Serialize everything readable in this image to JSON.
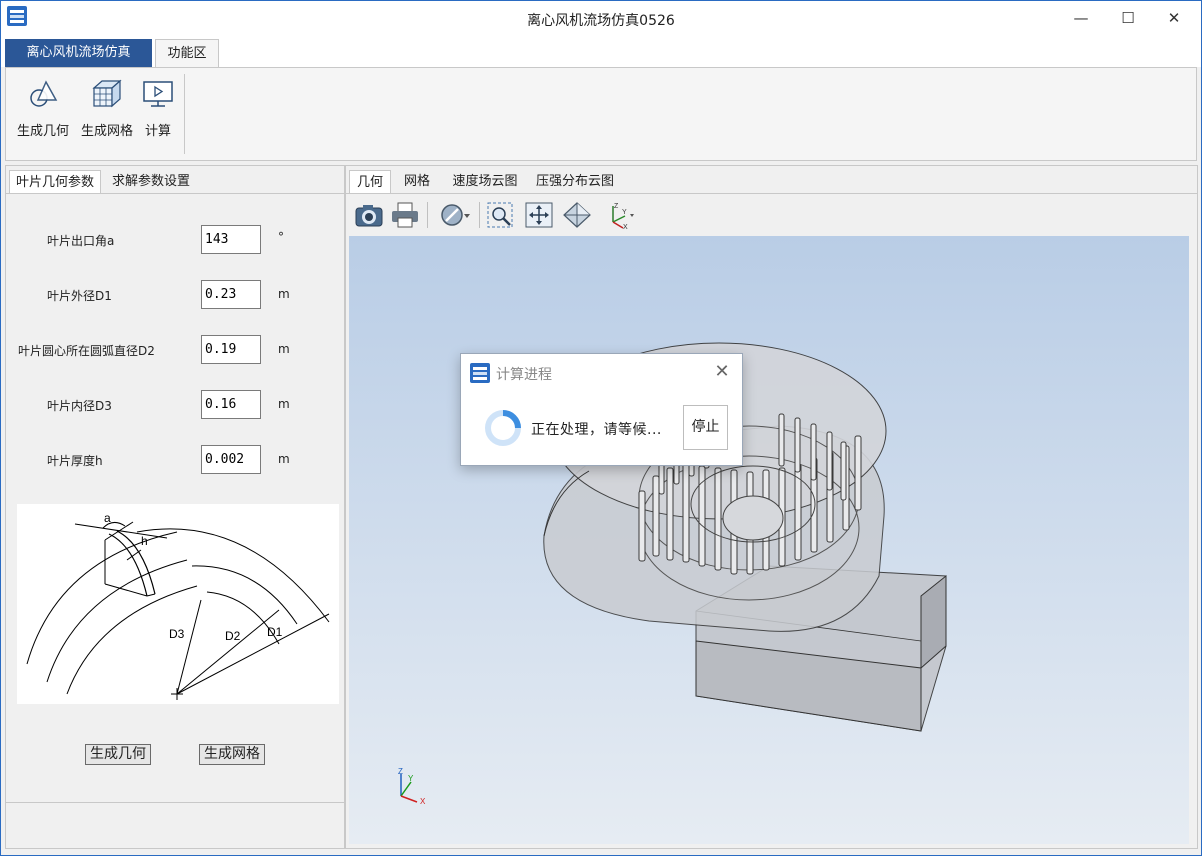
{
  "window": {
    "title": "离心风机流场仿真0526",
    "minimize": "—",
    "maximize": "☐",
    "close": "✕"
  },
  "ribbon": {
    "tabs": [
      "离心风机流场仿真",
      "功能区"
    ],
    "buttons": [
      {
        "label": "生成几何",
        "icon": "geometry-icon"
      },
      {
        "label": "生成网格",
        "icon": "mesh-icon"
      },
      {
        "label": "计算",
        "icon": "compute-icon"
      }
    ]
  },
  "left_panel": {
    "tabs": [
      "叶片几何参数",
      "求解参数设置"
    ],
    "params": [
      {
        "label": "叶片出口角a",
        "value": "143",
        "unit": "°"
      },
      {
        "label": "叶片外径D1",
        "value": "0.23",
        "unit": "m"
      },
      {
        "label": "叶片圆心所在圆弧直径D2",
        "value": "0.19",
        "unit": "m"
      },
      {
        "label": "叶片内径D3",
        "value": "0.16",
        "unit": "m"
      },
      {
        "label": "叶片厚度h",
        "value": "0.002",
        "unit": "m"
      }
    ],
    "diagram_labels": {
      "a": "a",
      "h": "h",
      "d1": "D1",
      "d2": "D2",
      "d3": "D3"
    },
    "buttons": {
      "gen_geometry": "生成几何",
      "gen_mesh": "生成网格"
    }
  },
  "right_panel": {
    "tabs": [
      "几何",
      "网格",
      "速度场云图",
      "压强分布云图"
    ],
    "toolbar": [
      "camera-icon",
      "print-icon",
      "render-mode-icon",
      "zoom-box-icon",
      "fit-all-icon",
      "iso-view-icon",
      "axes-icon"
    ],
    "axis_labels": {
      "x": "X",
      "y": "Y",
      "z": "Z"
    }
  },
  "dialog": {
    "title": "计算进程",
    "close": "✕",
    "message": "正在处理，请等候...",
    "stop": "停止"
  },
  "colors": {
    "app_tab": "#2b5797",
    "accent": "#2a6bc2",
    "viewport_top": "#b9cde6",
    "viewport_bottom": "#e6ecf3"
  }
}
